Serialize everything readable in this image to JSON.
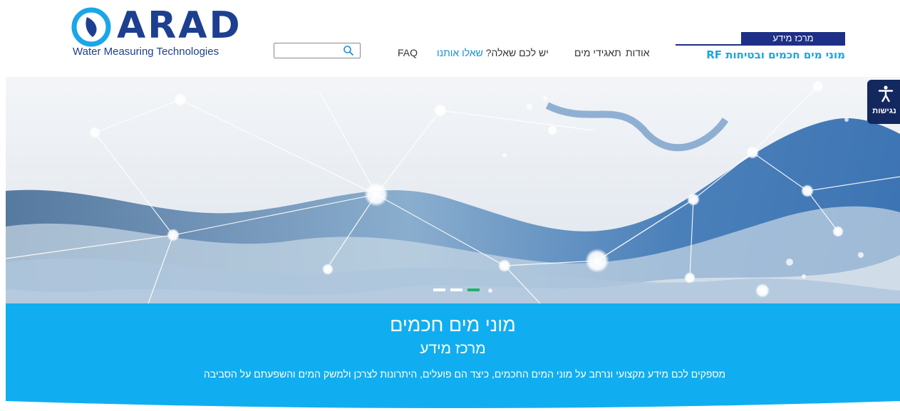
{
  "logo": {
    "word": "ARAD",
    "tagline": "Water Measuring Technologies"
  },
  "search": {
    "placeholder": "",
    "value": ""
  },
  "nav": {
    "faq": "FAQ",
    "ask_prefix": "יש לכם שאלה?",
    "ask_link": "שאלו אותנו",
    "tariffs": "תאגידי מים",
    "about": "אודות"
  },
  "info_center": {
    "badge": "מרכז מידע",
    "title": "מוני מים חכמים ובטיחות RF"
  },
  "accessibility": {
    "label": "נגישות"
  },
  "slider": {
    "slide_count": 3,
    "active_index": 2
  },
  "band": {
    "title": "מוני מים חכמים",
    "subtitle": "מרכז מידע",
    "description": "מספקים לכם מידע מקצועי ונרחב על מוני המים החכמים, כיצד הם פועלים, היתרונות לצרכן ולמשק המים והשפעתם על הסביבה"
  },
  "colors": {
    "brand_navy": "#1d2f86",
    "brand_blue": "#1d3f8f",
    "accent_cyan": "#1aa6e8",
    "band_blue": "#10aef0",
    "link_blue": "#1a8fd6",
    "dot_active": "#20b36a",
    "access_bg": "#12285e"
  }
}
